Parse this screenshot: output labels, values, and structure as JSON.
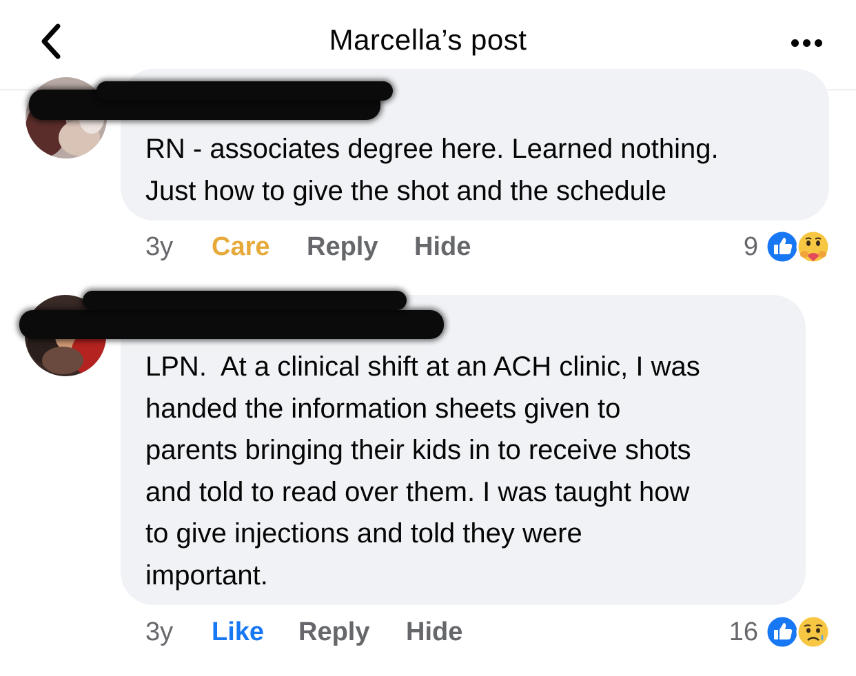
{
  "header": {
    "title": "Marcella’s post"
  },
  "comments": [
    {
      "text": "RN - associates degree here. Learned nothing.\nJust how to give the shot and the schedule",
      "time": "3y",
      "reaction_label": "Care",
      "reaction_color": "#e7a93a",
      "reply_label": "Reply",
      "hide_label": "Hide",
      "reaction_count": "9",
      "reaction_icons": [
        "like-icon",
        "care-icon"
      ]
    },
    {
      "text": "LPN.  At a clinical shift at an ACH clinic, I was\nhanded the information sheets given to\nparents bringing their kids in to receive shots\nand told to read over them. I was taught how\nto give injections and told they were\nimportant.",
      "time": "3y",
      "reaction_label": "Like",
      "reaction_color": "#1877f2",
      "reply_label": "Reply",
      "hide_label": "Hide",
      "reaction_count": "16",
      "reaction_icons": [
        "like-icon",
        "sad-icon"
      ]
    }
  ],
  "colors": {
    "bubble": "#f0f2f5",
    "muted": "#65676b",
    "like_blue": "#1877f2"
  }
}
